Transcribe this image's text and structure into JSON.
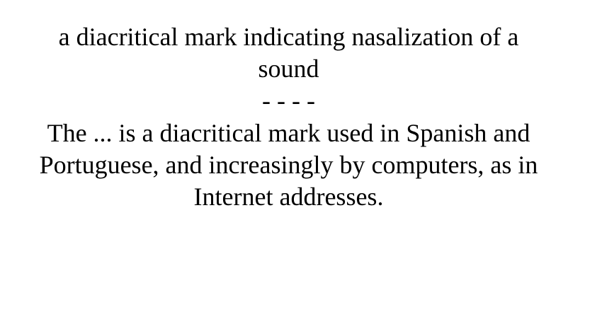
{
  "card": {
    "definition": "a diacritical mark indicating nasalization of a sound",
    "separator": "- - - -",
    "clue": "The ... is a diacritical mark used in Spanish and Portuguese, and increasingly by computers, as in Internet addresses."
  },
  "colors": {
    "background": "#ffffff",
    "text": "#000000"
  }
}
